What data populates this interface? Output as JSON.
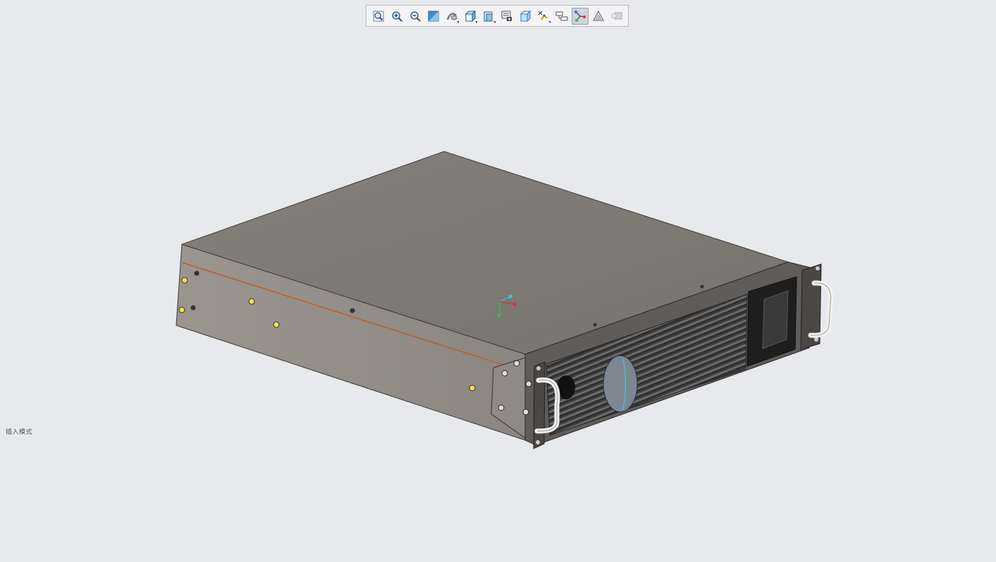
{
  "toolbar": {
    "tools": [
      {
        "name": "zoom-fit",
        "icon": "zoom-fit-icon"
      },
      {
        "name": "zoom-in",
        "icon": "zoom-in-icon"
      },
      {
        "name": "zoom-out",
        "icon": "zoom-out-icon"
      },
      {
        "name": "zoom-area",
        "icon": "zoom-area-icon"
      },
      {
        "name": "pan-rotate",
        "icon": "rotate-view-icon"
      },
      {
        "name": "view-orientation",
        "icon": "view-cube-icon"
      },
      {
        "name": "section-view",
        "icon": "section-view-icon"
      },
      {
        "name": "display-style",
        "icon": "display-style-icon"
      },
      {
        "name": "hide-show",
        "icon": "hide-show-icon"
      },
      {
        "name": "view-settings",
        "icon": "view-settings-icon"
      },
      {
        "name": "apply-scene",
        "icon": "apply-scene-icon"
      },
      {
        "name": "view-origins",
        "icon": "view-origins-icon",
        "active": true
      },
      {
        "name": "appearance",
        "icon": "appearance-icon"
      },
      {
        "name": "annotations",
        "icon": "annotations-icon",
        "disabled": true
      }
    ]
  },
  "status": {
    "mode_label": "插入模式"
  },
  "colors": {
    "background": "#e8e9ec",
    "chassis_top": "#7e7a74",
    "chassis_side": "#918c87",
    "accent_edge": "#c05a1a",
    "triad_x": "#e0302c",
    "triad_y": "#2bc44a",
    "triad_z": "#3fc6e6"
  }
}
